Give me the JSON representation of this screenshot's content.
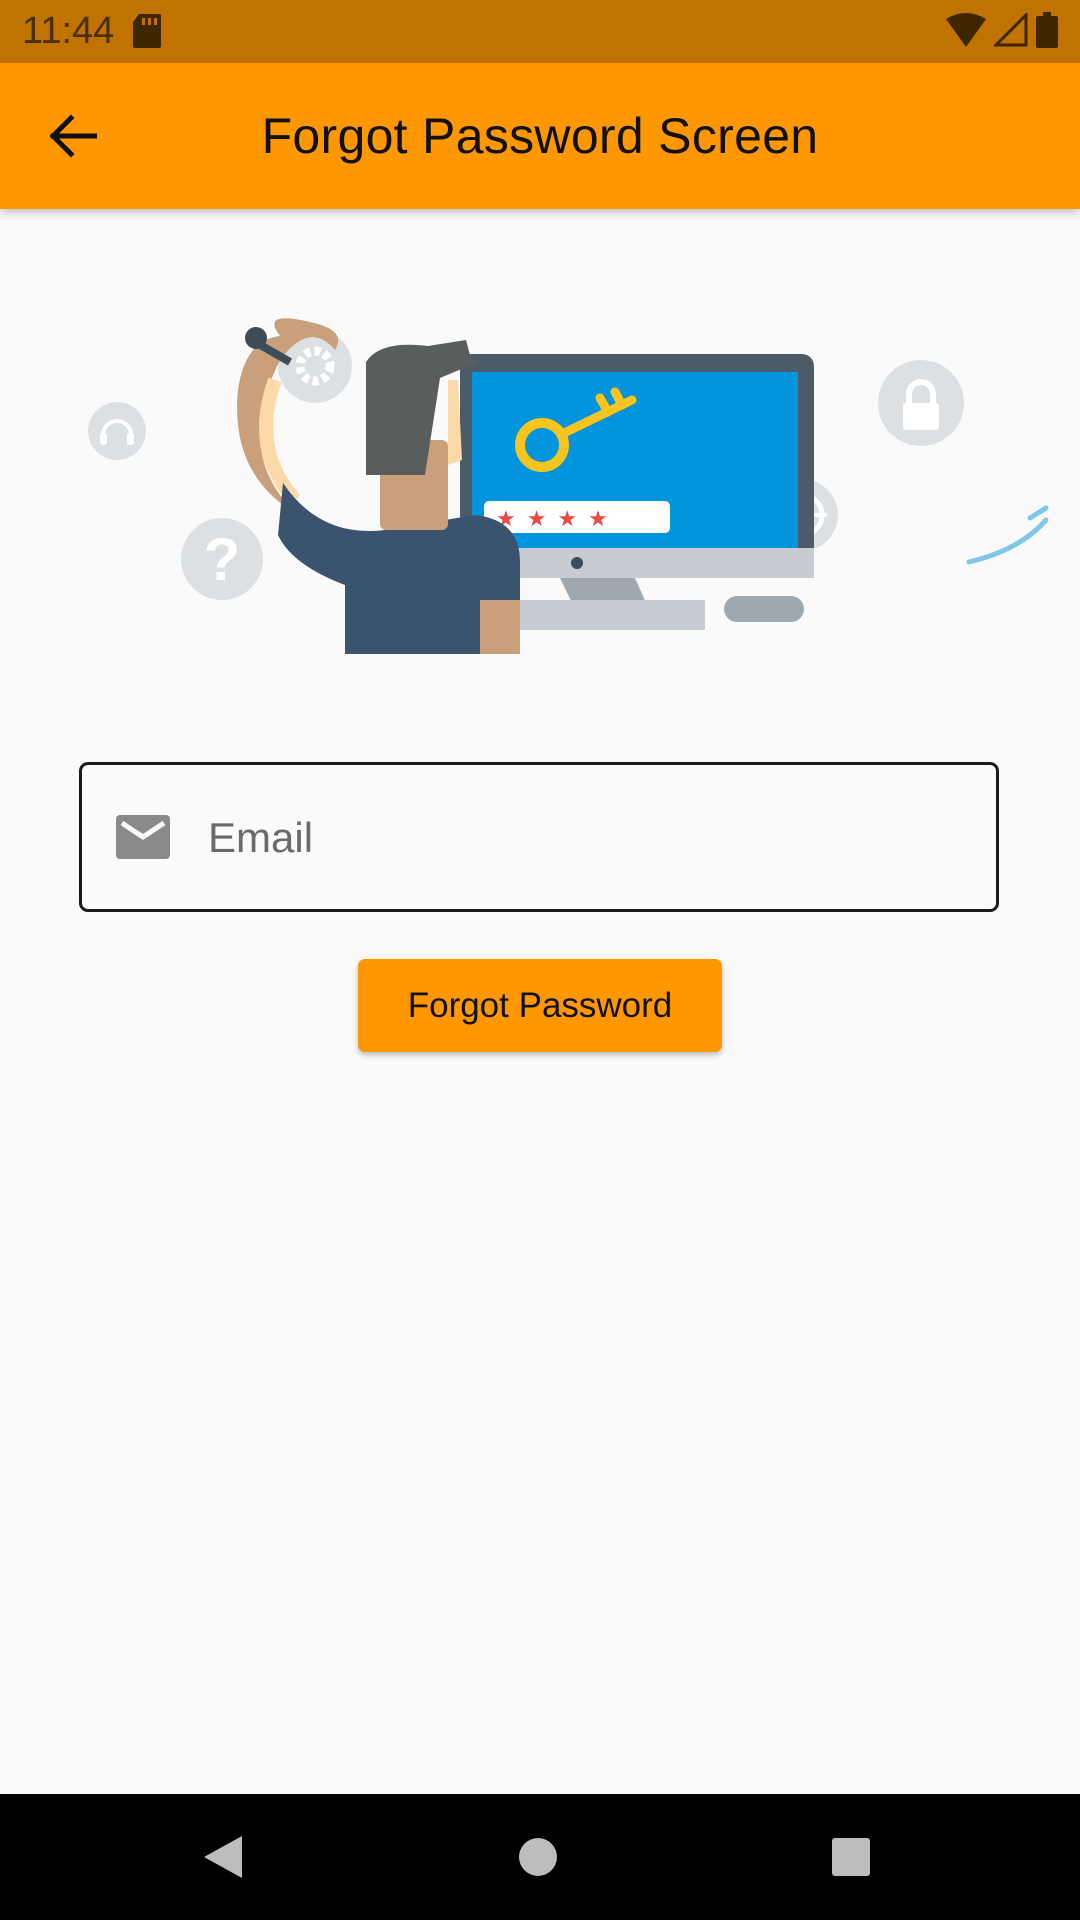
{
  "status_bar": {
    "time": "11:44",
    "icons": [
      "sd-card-icon",
      "wifi-icon",
      "cell-signal-icon",
      "battery-icon"
    ]
  },
  "app_bar": {
    "title": "Forgot Password Screen",
    "back_icon": "arrow-back-icon",
    "color": "#ff9800"
  },
  "illustration": {
    "name": "forgot-password-illustration",
    "password_stars": "★ ★ ★ ★"
  },
  "form": {
    "email_placeholder": "Email",
    "email_value": "",
    "email_icon": "mail-icon",
    "submit_label": "Forgot Password"
  },
  "nav_bar": {
    "icons": [
      "nav-back-icon",
      "nav-home-icon",
      "nav-recents-icon"
    ]
  },
  "colors": {
    "accent": "#ff9800",
    "status_bar": "#c07300",
    "background": "#fafafa"
  }
}
